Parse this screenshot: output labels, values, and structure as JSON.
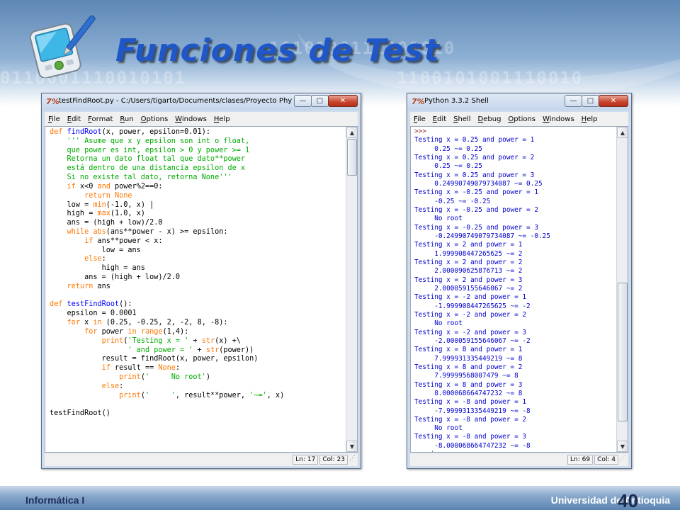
{
  "slide": {
    "title": "Funciones de Test",
    "footer_left": "Informática I",
    "footer_right": "Universidad de Antioquia",
    "page_number": "40",
    "binary_rows": [
      "1010100111001010",
      "0110001110010101",
      "1100101001110010"
    ],
    "icon": "pda-stylus-icon"
  },
  "editor_window": {
    "app_icon": "7%",
    "title": "testFindRoot.py - C:/Users/tigarto/Documents/clases/Proyecto Phyt...",
    "controls": {
      "minimize": "—",
      "maximize": "□",
      "close": "✕"
    },
    "menus": [
      "File",
      "Edit",
      "Format",
      "Run",
      "Options",
      "Windows",
      "Help"
    ],
    "status": {
      "line": "Ln: 17",
      "col": "Col: 23"
    },
    "code_lines": [
      [
        [
          "kw",
          "def "
        ],
        [
          "fn",
          "findRoot"
        ],
        [
          "",
          "(x, power, epsilon=0.01):"
        ]
      ],
      [
        [
          "str",
          "    ''' Asume que x y epsilon son int o float,"
        ]
      ],
      [
        [
          "str",
          "    que power es int, epsilon > 0 y power >= 1"
        ]
      ],
      [
        [
          "str",
          "    Retorna un dato float tal que dato**power"
        ]
      ],
      [
        [
          "str",
          "    está dentro de una distancia epsilon de x"
        ]
      ],
      [
        [
          "str",
          "    Si no existe tal dato, retorna None'''"
        ]
      ],
      [
        [
          "",
          "    "
        ],
        [
          "kw",
          "if"
        ],
        [
          "",
          " x<0 "
        ],
        [
          "kw",
          "and"
        ],
        [
          "",
          " power%2==0:"
        ]
      ],
      [
        [
          "",
          "        "
        ],
        [
          "kw",
          "return None"
        ]
      ],
      [
        [
          "",
          "    low = "
        ],
        [
          "kw",
          "min"
        ],
        [
          "",
          "(-1.0, x) "
        ],
        [
          "cursor",
          "|"
        ]
      ],
      [
        [
          "",
          "    high = "
        ],
        [
          "kw",
          "max"
        ],
        [
          "",
          "(1.0, x)"
        ]
      ],
      [
        [
          "",
          "    ans = (high + low)/2.0"
        ]
      ],
      [
        [
          "",
          "    "
        ],
        [
          "kw",
          "while"
        ],
        [
          "",
          " "
        ],
        [
          "kw",
          "abs"
        ],
        [
          "",
          "(ans**power - x) >= epsilon:"
        ]
      ],
      [
        [
          "",
          "        "
        ],
        [
          "kw",
          "if"
        ],
        [
          "",
          " ans**power < x:"
        ]
      ],
      [
        [
          "",
          "            low = ans"
        ]
      ],
      [
        [
          "",
          "        "
        ],
        [
          "kw",
          "else"
        ],
        [
          "",
          ":"
        ]
      ],
      [
        [
          "",
          "            high = ans"
        ]
      ],
      [
        [
          "",
          "        ans = (high + low)/2.0"
        ]
      ],
      [
        [
          "",
          "    "
        ],
        [
          "kw",
          "return"
        ],
        [
          "",
          " ans"
        ]
      ],
      [
        [
          "",
          ""
        ]
      ],
      [
        [
          "kw",
          "def "
        ],
        [
          "fn",
          "testFindRoot"
        ],
        [
          "",
          "():"
        ]
      ],
      [
        [
          "",
          "    epsilon = 0.0001"
        ]
      ],
      [
        [
          "",
          "    "
        ],
        [
          "kw",
          "for"
        ],
        [
          "",
          " x "
        ],
        [
          "kw",
          "in"
        ],
        [
          "",
          " (0.25, -0.25, 2, -2, 8, -8):"
        ]
      ],
      [
        [
          "",
          "        "
        ],
        [
          "kw",
          "for"
        ],
        [
          "",
          " power "
        ],
        [
          "kw",
          "in"
        ],
        [
          "",
          " "
        ],
        [
          "kw",
          "range"
        ],
        [
          "",
          "(1,4):"
        ]
      ],
      [
        [
          "",
          "            "
        ],
        [
          "kw",
          "print"
        ],
        [
          "",
          "("
        ],
        [
          "str",
          "'Testing x = '"
        ],
        [
          "",
          " + "
        ],
        [
          "kw",
          "str"
        ],
        [
          "",
          "(x) +\\"
        ]
      ],
      [
        [
          "",
          "                  "
        ],
        [
          "str",
          "' and power = '"
        ],
        [
          "",
          " + "
        ],
        [
          "kw",
          "str"
        ],
        [
          "",
          "(power))"
        ]
      ],
      [
        [
          "",
          "            result = findRoot(x, power, epsilon)"
        ]
      ],
      [
        [
          "",
          "            "
        ],
        [
          "kw",
          "if"
        ],
        [
          "",
          " result == "
        ],
        [
          "kw",
          "None"
        ],
        [
          "",
          ":"
        ]
      ],
      [
        [
          "",
          "                "
        ],
        [
          "kw",
          "print"
        ],
        [
          "",
          "("
        ],
        [
          "str",
          "'     No root'"
        ],
        [
          "",
          ")"
        ]
      ],
      [
        [
          "",
          "            "
        ],
        [
          "kw",
          "else"
        ],
        [
          "",
          ":"
        ]
      ],
      [
        [
          "",
          "                "
        ],
        [
          "kw",
          "print"
        ],
        [
          "",
          "("
        ],
        [
          "str",
          "'     '"
        ],
        [
          "",
          ", result**power, "
        ],
        [
          "str",
          "'~='"
        ],
        [
          "",
          ", x)"
        ]
      ],
      [
        [
          "",
          ""
        ]
      ],
      [
        [
          "",
          "testFindRoot()"
        ]
      ]
    ]
  },
  "shell_window": {
    "app_icon": "7%",
    "title": "Python 3.3.2 Shell",
    "controls": {
      "minimize": "—",
      "maximize": "□",
      "close": "✕"
    },
    "menus": [
      "File",
      "Edit",
      "Shell",
      "Debug",
      "Options",
      "Windows",
      "Help"
    ],
    "status": {
      "line": "Ln: 69",
      "col": "Col: 4"
    },
    "lines": [
      [
        "prompt",
        ">>>"
      ],
      [
        "out",
        "Testing x = 0.25 and power = 1"
      ],
      [
        "out",
        "     0.25 ~= 0.25"
      ],
      [
        "out",
        "Testing x = 0.25 and power = 2"
      ],
      [
        "out",
        "     0.25 ~= 0.25"
      ],
      [
        "out",
        "Testing x = 0.25 and power = 3"
      ],
      [
        "out",
        "     0.24990749079734087 ~= 0.25"
      ],
      [
        "out",
        "Testing x = -0.25 and power = 1"
      ],
      [
        "out",
        "     -0.25 ~= -0.25"
      ],
      [
        "out",
        "Testing x = -0.25 and power = 2"
      ],
      [
        "out",
        "     No root"
      ],
      [
        "out",
        "Testing x = -0.25 and power = 3"
      ],
      [
        "out",
        "     -0.24990749079734087 ~= -0.25"
      ],
      [
        "out",
        "Testing x = 2 and power = 1"
      ],
      [
        "out",
        "     1.999908447265625 ~= 2"
      ],
      [
        "out",
        "Testing x = 2 and power = 2"
      ],
      [
        "out",
        "     2.000090625876713 ~= 2"
      ],
      [
        "out",
        "Testing x = 2 and power = 3"
      ],
      [
        "out",
        "     2.000059155646067 ~= 2"
      ],
      [
        "out",
        "Testing x = -2 and power = 1"
      ],
      [
        "out",
        "     -1.999908447265625 ~= -2"
      ],
      [
        "out",
        "Testing x = -2 and power = 2"
      ],
      [
        "out",
        "     No root"
      ],
      [
        "out",
        "Testing x = -2 and power = 3"
      ],
      [
        "out",
        "     -2.000059155646067 ~= -2"
      ],
      [
        "out",
        "Testing x = 8 and power = 1"
      ],
      [
        "out",
        "     7.999931335449219 ~= 8"
      ],
      [
        "out",
        "Testing x = 8 and power = 2"
      ],
      [
        "out",
        "     7.99999568007479 ~= 8"
      ],
      [
        "out",
        "Testing x = 8 and power = 3"
      ],
      [
        "out",
        "     8.000068664747232 ~= 8"
      ],
      [
        "out",
        "Testing x = -8 and power = 1"
      ],
      [
        "out",
        "     -7.999931335449219 ~= -8"
      ],
      [
        "out",
        "Testing x = -8 and power = 2"
      ],
      [
        "out",
        "     No root"
      ],
      [
        "out",
        "Testing x = -8 and power = 3"
      ],
      [
        "out",
        "     -8.000068664747232 ~= -8"
      ],
      [
        "prompt",
        ">>> |"
      ]
    ]
  }
}
